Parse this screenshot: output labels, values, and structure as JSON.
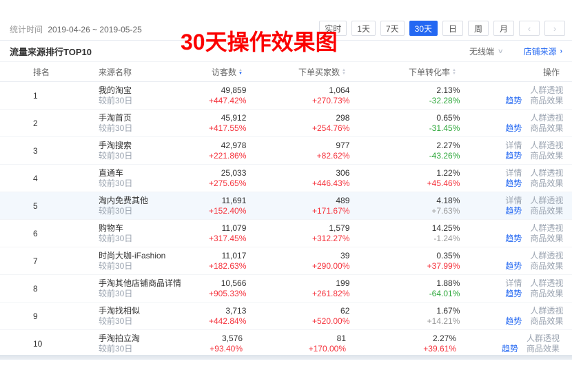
{
  "overlay": {
    "text": "30天操作效果图",
    "color": "#fb0000"
  },
  "toolbar": {
    "stat_time_label": "统计时间",
    "stat_time_range": "2019-04-26 ~ 2019-05-25",
    "period_buttons": [
      {
        "label": "实时",
        "active": false
      },
      {
        "label": "1天",
        "active": false
      },
      {
        "label": "7天",
        "active": false
      },
      {
        "label": "30天",
        "active": true
      },
      {
        "label": "日",
        "active": false
      },
      {
        "label": "周",
        "active": false
      },
      {
        "label": "月",
        "active": false
      }
    ],
    "prev_label": "‹",
    "next_label": "›"
  },
  "panel": {
    "title": "流量来源排行TOP10",
    "terminal_filter": "无线端",
    "chevron_down_icon": "∨",
    "source_link": "店铺来源",
    "chevron_right_icon": "›"
  },
  "table": {
    "headers": {
      "rank": "排名",
      "name": "来源名称",
      "visitors": "访客数",
      "buyers": "下单买家数",
      "conversion": "下单转化率",
      "ops": "操作"
    },
    "sort": {
      "active_column": "visitors",
      "direction": "desc"
    },
    "compare_label": "较前30日",
    "ops_labels": {
      "detail": "详情",
      "crowd": "人群透视",
      "trend": "趋势",
      "product": "商品效果"
    },
    "rows": [
      {
        "rank": "1",
        "name": "我的淘宝",
        "visitors": "49,859",
        "visitors_chg": "+447.42%",
        "visitors_dir": "up",
        "buyers": "1,064",
        "buyers_chg": "+270.73%",
        "buyers_dir": "up",
        "conversion": "2.13%",
        "conversion_chg": "-32.28%",
        "conversion_dir": "down",
        "has_detail": false,
        "highlighted": false
      },
      {
        "rank": "2",
        "name": "手淘首页",
        "visitors": "45,912",
        "visitors_chg": "+417.55%",
        "visitors_dir": "up",
        "buyers": "298",
        "buyers_chg": "+254.76%",
        "buyers_dir": "up",
        "conversion": "0.65%",
        "conversion_chg": "-31.45%",
        "conversion_dir": "down",
        "has_detail": false,
        "highlighted": false
      },
      {
        "rank": "3",
        "name": "手淘搜索",
        "visitors": "42,978",
        "visitors_chg": "+221.86%",
        "visitors_dir": "up",
        "buyers": "977",
        "buyers_chg": "+82.62%",
        "buyers_dir": "up",
        "conversion": "2.27%",
        "conversion_chg": "-43.26%",
        "conversion_dir": "down",
        "has_detail": true,
        "highlighted": false
      },
      {
        "rank": "4",
        "name": "直通车",
        "visitors": "25,033",
        "visitors_chg": "+275.65%",
        "visitors_dir": "up",
        "buyers": "306",
        "buyers_chg": "+446.43%",
        "buyers_dir": "up",
        "conversion": "1.22%",
        "conversion_chg": "+45.46%",
        "conversion_dir": "up",
        "has_detail": true,
        "highlighted": false
      },
      {
        "rank": "5",
        "name": "淘内免费其他",
        "visitors": "11,691",
        "visitors_chg": "+152.40%",
        "visitors_dir": "up",
        "buyers": "489",
        "buyers_chg": "+171.67%",
        "buyers_dir": "up",
        "conversion": "4.18%",
        "conversion_chg": "+7.63%",
        "conversion_dir": "flat",
        "has_detail": true,
        "highlighted": true
      },
      {
        "rank": "6",
        "name": "购物车",
        "visitors": "11,079",
        "visitors_chg": "+317.45%",
        "visitors_dir": "up",
        "buyers": "1,579",
        "buyers_chg": "+312.27%",
        "buyers_dir": "up",
        "conversion": "14.25%",
        "conversion_chg": "-1.24%",
        "conversion_dir": "flat",
        "has_detail": false,
        "highlighted": false
      },
      {
        "rank": "7",
        "name": "时尚大咖-iFashion",
        "visitors": "11,017",
        "visitors_chg": "+182.63%",
        "visitors_dir": "up",
        "buyers": "39",
        "buyers_chg": "+290.00%",
        "buyers_dir": "up",
        "conversion": "0.35%",
        "conversion_chg": "+37.99%",
        "conversion_dir": "up",
        "has_detail": false,
        "highlighted": false
      },
      {
        "rank": "8",
        "name": "手淘其他店铺商品详情",
        "visitors": "10,566",
        "visitors_chg": "+905.33%",
        "visitors_dir": "up",
        "buyers": "199",
        "buyers_chg": "+261.82%",
        "buyers_dir": "up",
        "conversion": "1.88%",
        "conversion_chg": "-64.01%",
        "conversion_dir": "down",
        "has_detail": true,
        "highlighted": false
      },
      {
        "rank": "9",
        "name": "手淘找相似",
        "visitors": "3,713",
        "visitors_chg": "+442.84%",
        "visitors_dir": "up",
        "buyers": "62",
        "buyers_chg": "+520.00%",
        "buyers_dir": "up",
        "conversion": "1.67%",
        "conversion_chg": "+14.21%",
        "conversion_dir": "flat",
        "has_detail": false,
        "highlighted": false
      },
      {
        "rank": "10",
        "name": "手淘拍立淘",
        "visitors": "3,576",
        "visitors_chg": "+93.40%",
        "visitors_dir": "up",
        "buyers": "81",
        "buyers_chg": "+170.00%",
        "buyers_dir": "up",
        "conversion": "2.27%",
        "conversion_chg": "+39.61%",
        "conversion_dir": "up",
        "has_detail": false,
        "highlighted": false
      }
    ]
  }
}
